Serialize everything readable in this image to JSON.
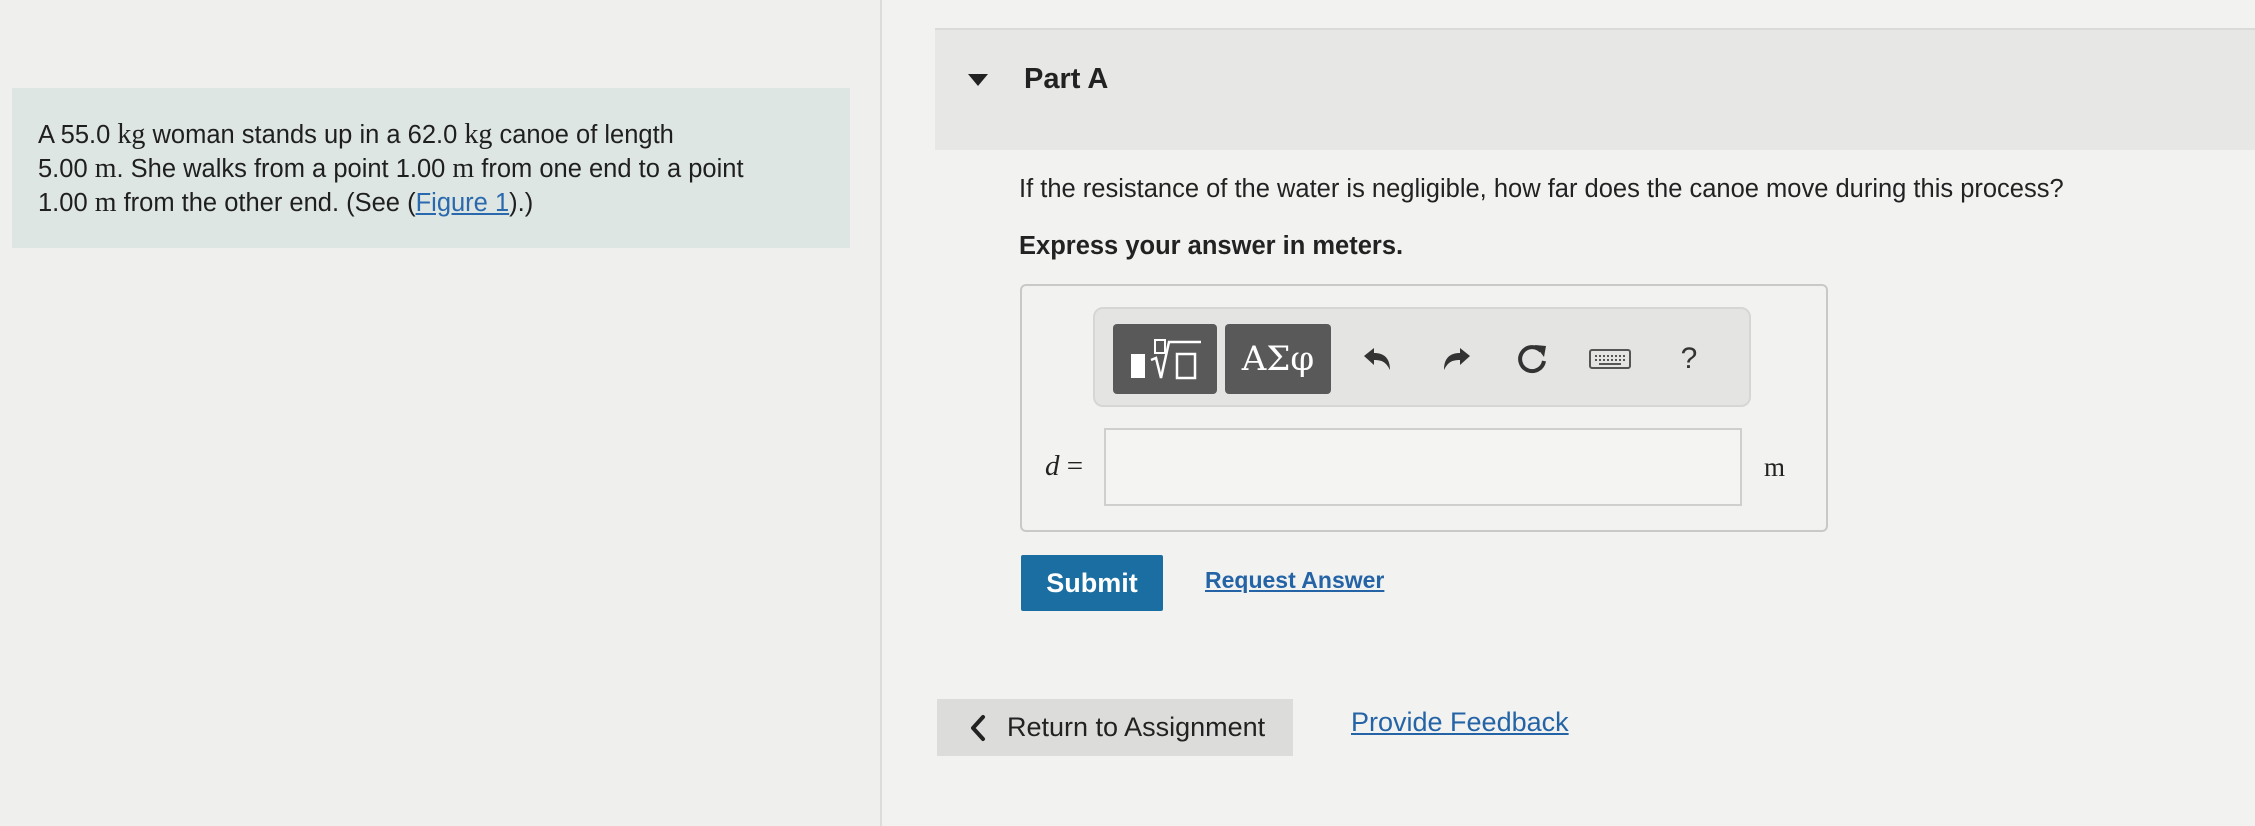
{
  "problem": {
    "t1": "A 55.0 ",
    "q1": "kg",
    "t2": " woman stands up in a 62.0 ",
    "q2": "kg",
    "t3": " canoe of length",
    "t4": "5.00 ",
    "q4": "m",
    "t5": ". She walks from a point 1.00 ",
    "q5": "m",
    "t6": " from one end to a point",
    "t7": "1.00 ",
    "q7": "m",
    "t8": " from the other end. (See (",
    "figure_link": "Figure 1",
    "t9": ").)"
  },
  "part": {
    "title": "Part A",
    "question": "If the resistance of the water is negligible, how far does the canoe move during this process?",
    "instruction": "Express your answer in meters."
  },
  "toolbar": {
    "templates_icon": "templates-icon",
    "greek_label": "ΑΣφ",
    "undo_icon": "undo-icon",
    "redo_icon": "redo-icon",
    "reset_icon": "reset-icon",
    "keyboard_icon": "keyboard-icon",
    "help_label": "?"
  },
  "answer": {
    "variable": "d",
    "equals": "=",
    "value": "",
    "unit": "m"
  },
  "actions": {
    "submit": "Submit",
    "request_answer": "Request Answer"
  },
  "footer": {
    "return_label": "Return to Assignment",
    "feedback_label": "Provide Feedback"
  },
  "colors": {
    "problem_bg": "#dde6e2",
    "submit_bg": "#1a6ea1",
    "link": "#2464a6"
  }
}
